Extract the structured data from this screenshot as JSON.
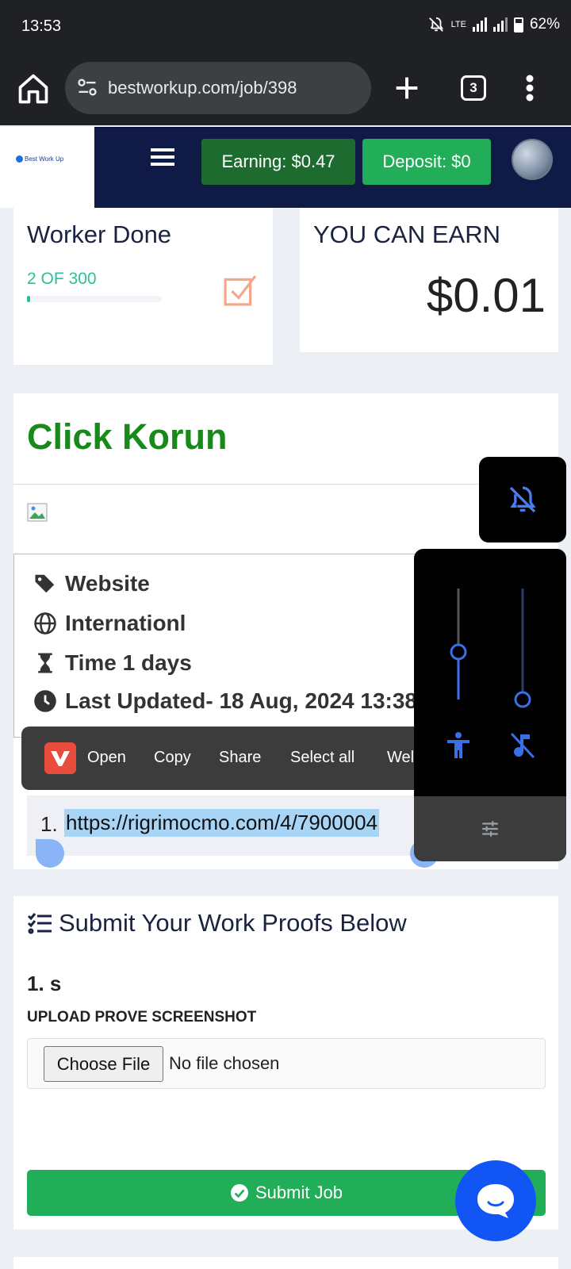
{
  "status_bar": {
    "time": "13:53",
    "network": "LTE",
    "battery": "62%"
  },
  "browser": {
    "url": "bestworkup.com/job/398",
    "tab_count": "3"
  },
  "header": {
    "logo_text": "Best Work Up",
    "earning": "Earning: $0.47",
    "deposit": "Deposit: $0"
  },
  "stats": {
    "worker_title": "Worker Done",
    "worker_count": "2 OF 300",
    "progress_fraction": 0.0067,
    "earn_title": "YOU CAN EARN",
    "earn_amount": "$0.01"
  },
  "job": {
    "title": "Click Korun",
    "category": "Website",
    "region": "Internationl",
    "time": "Time 1 days",
    "updated": "Last Updated- 18 Aug, 2024 13:38:",
    "link_number": "1.",
    "link": "https://rigrimocmo.com/4/7900004"
  },
  "context_menu": {
    "open": "Open",
    "copy": "Copy",
    "share": "Share",
    "select_all": "Select all",
    "web": "Wel"
  },
  "volume": {
    "media_level": 0.4,
    "ring_level": 0.0
  },
  "submit": {
    "heading": "Submit Your Work Proofs Below",
    "proof_title": "1. s",
    "upload_label": "UPLOAD PROVE SCREENSHOT",
    "choose_file": "Choose File",
    "no_file": "No file chosen",
    "submit_label": "Submit Job"
  },
  "colors": {
    "header_bg": "#0f1b46",
    "accent_green": "#22ad58",
    "title_green": "#178a19",
    "chat_blue": "#1255f5"
  }
}
